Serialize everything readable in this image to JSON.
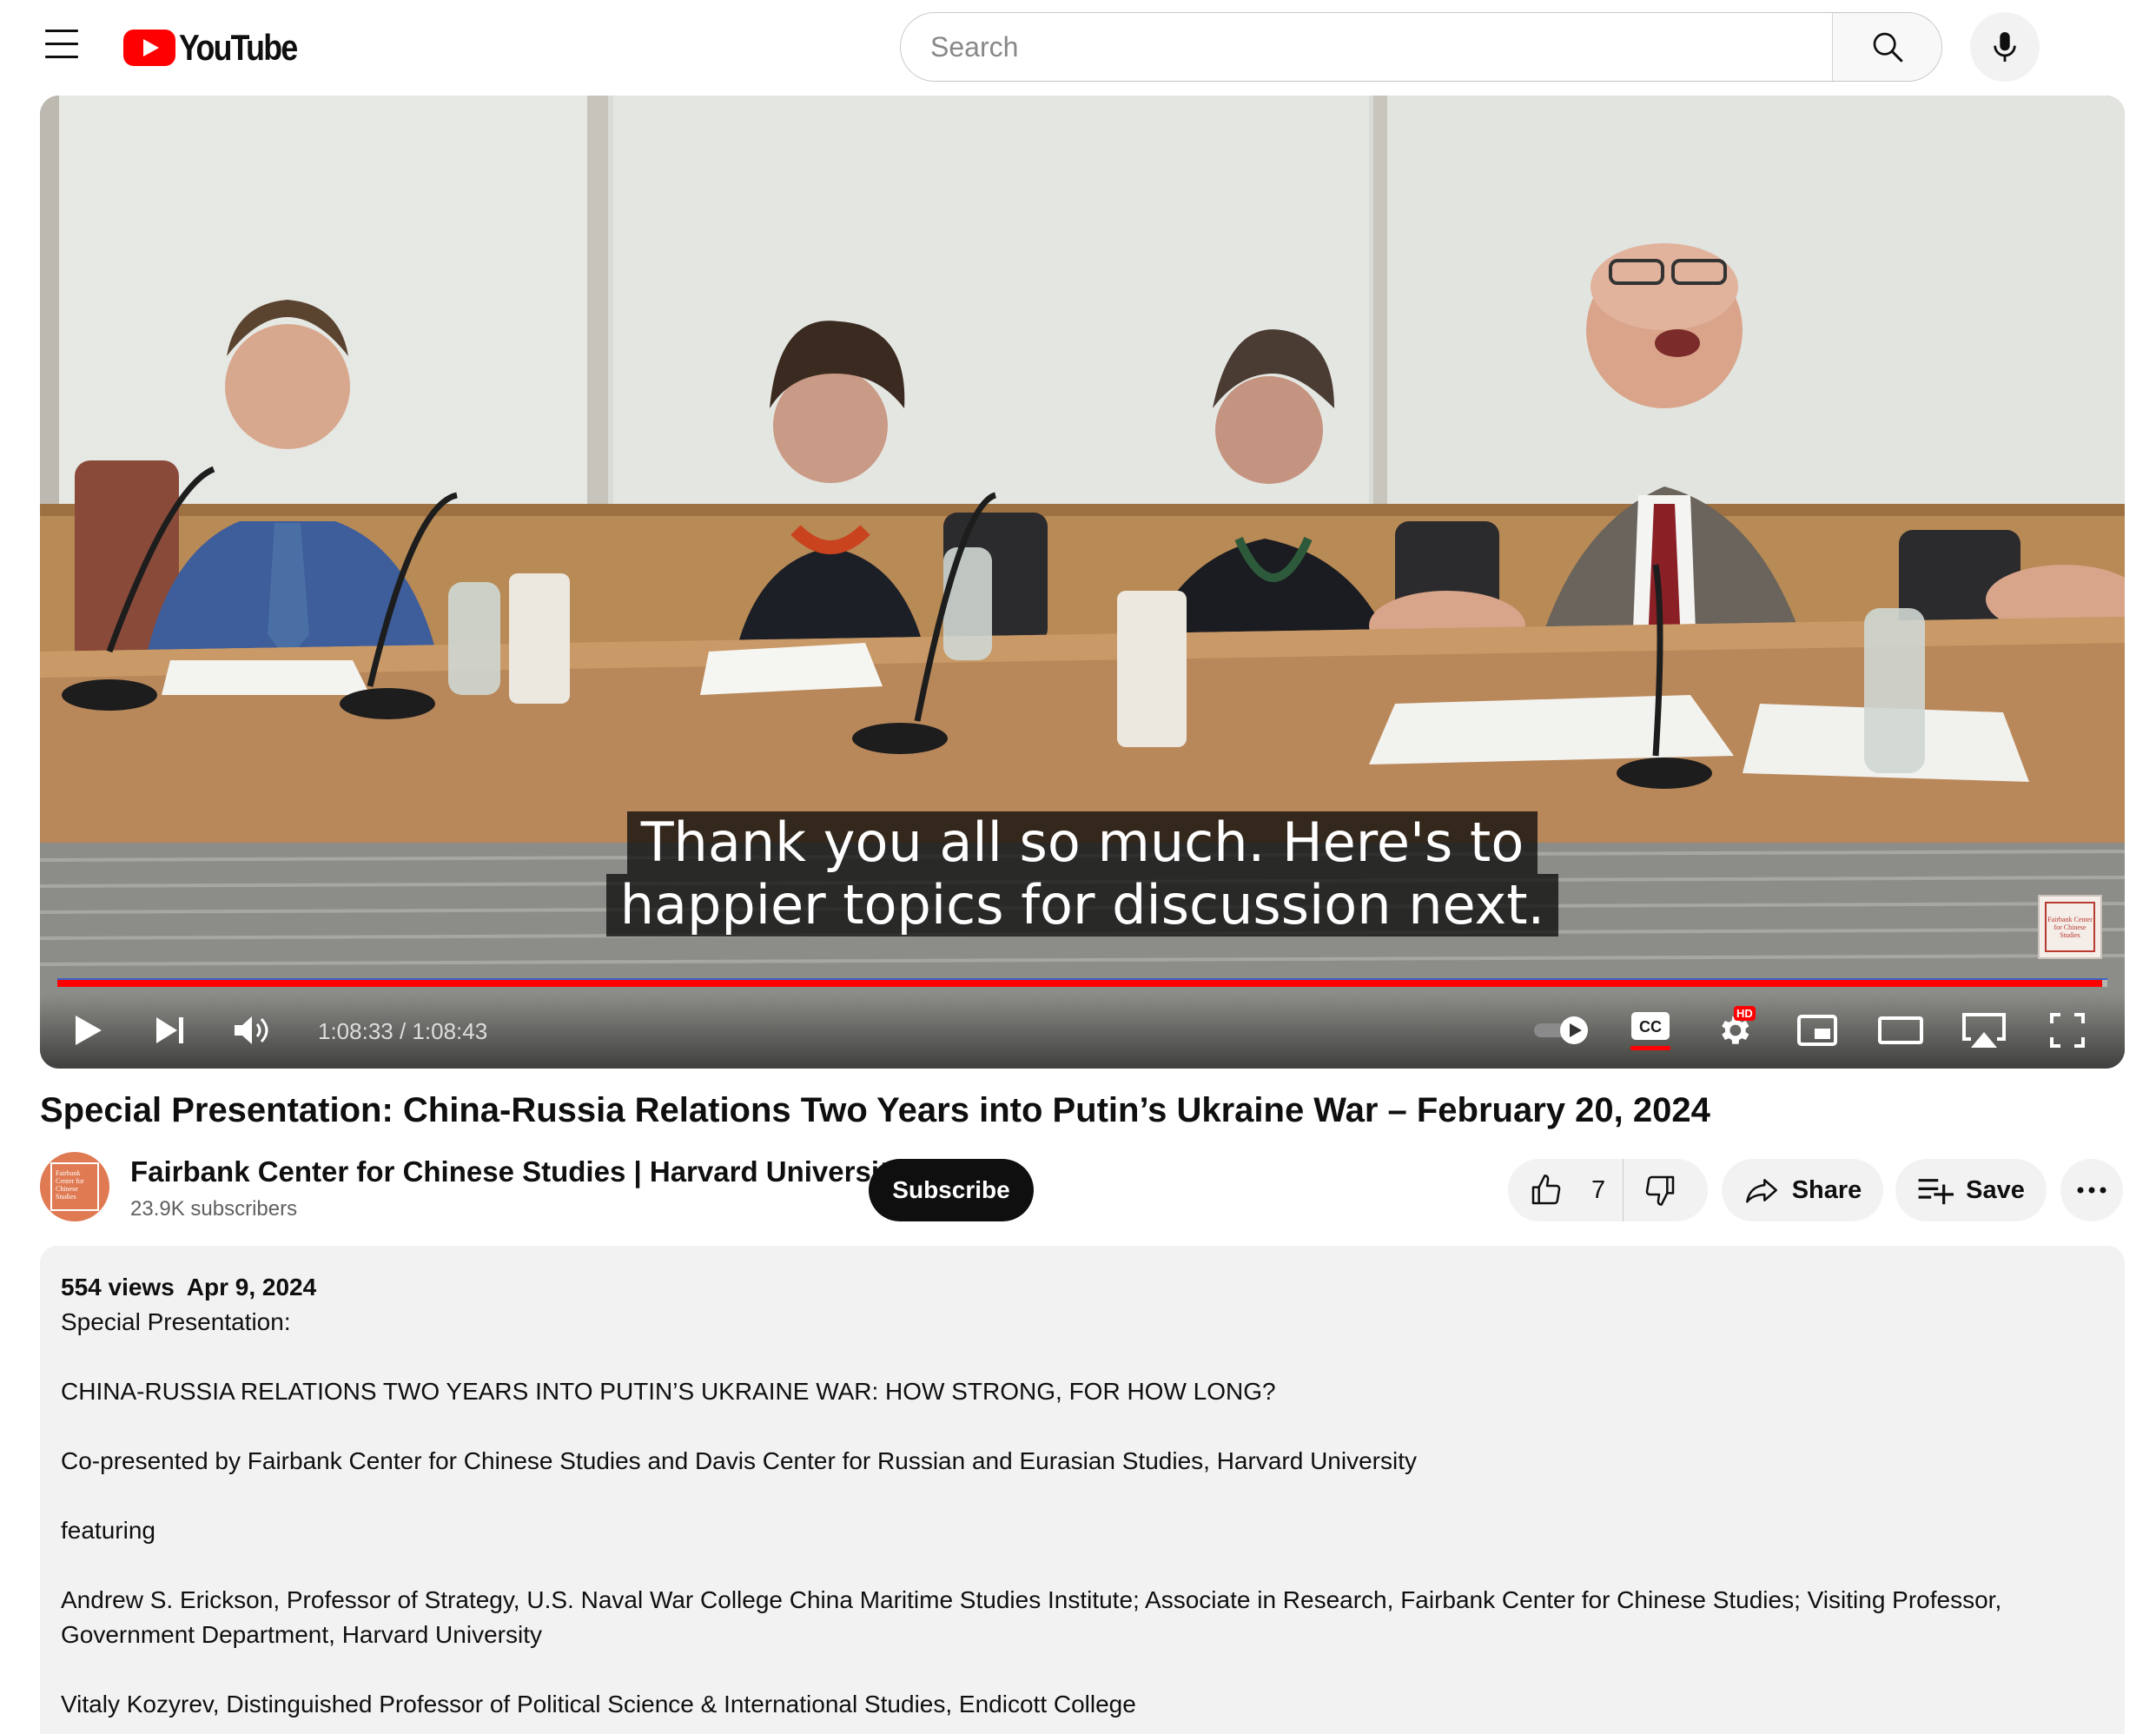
{
  "masthead": {
    "logo_text": "YouTube",
    "search_placeholder": "Search"
  },
  "player": {
    "subtitle_line1": "Thank you all so much. Here's to",
    "subtitle_line2": "happier topics for discussion next.",
    "time_current": "1:08:33",
    "time_separator": " / ",
    "time_total": "1:08:43",
    "progress_fraction": 0.9976,
    "watermark_text": "Fairbank Center for Chinese Studies",
    "hd_badge": "HD",
    "accent_color": "#ff0000"
  },
  "video": {
    "title": "Special Presentation: China-Russia Relations Two Years into Putin’s Ukraine War – February 20, 2024"
  },
  "channel": {
    "name": "Fairbank Center for Chinese Studies | Harvard University",
    "subscribers": "23.9K subscribers",
    "avatar_text": "Fairbank Center for Chinese Studies",
    "subscribe_label": "Subscribe"
  },
  "actions": {
    "like_count": "7",
    "share_label": "Share",
    "save_label": "Save"
  },
  "description": {
    "views": "554 views",
    "date": "Apr 9, 2024",
    "line1": "Special Presentation:",
    "line2": "CHINA-RUSSIA RELATIONS TWO YEARS INTO PUTIN’S UKRAINE WAR: HOW STRONG, FOR HOW LONG?",
    "line3": "Co-presented by Fairbank Center for Chinese Studies and Davis Center for Russian and Eurasian Studies, Harvard University",
    "line4": "featuring",
    "line5": "Andrew S. Erickson, Professor of Strategy, U.S. Naval War College China Maritime Studies Institute; Associate in Research, Fairbank Center for Chinese Studies; Visiting Professor, Government Department, Harvard University",
    "line6": "Vitaly Kozyrev, Distinguished Professor of Political Science & International Studies, Endicott College"
  }
}
